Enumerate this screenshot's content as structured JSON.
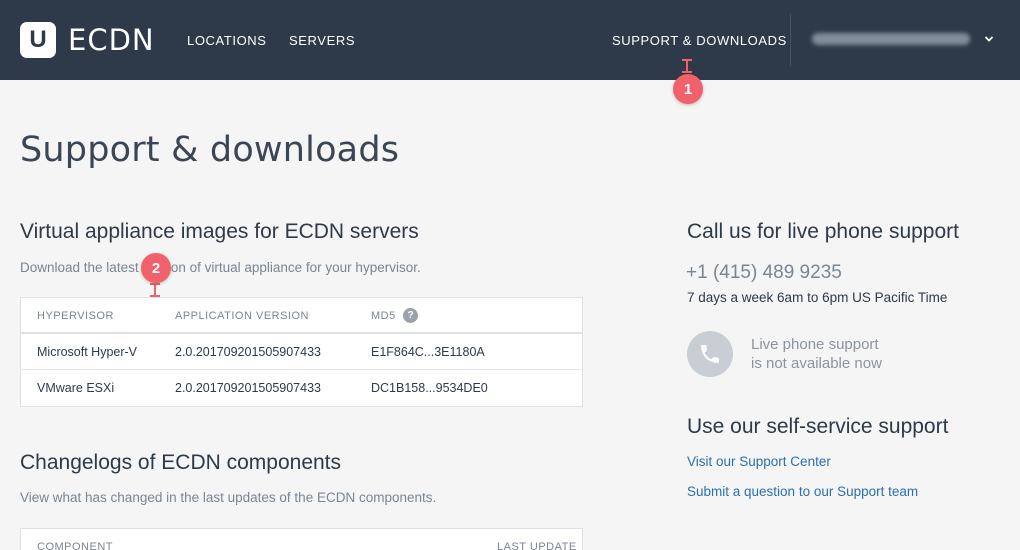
{
  "header": {
    "logo_mark": "U",
    "logo_text": "ECDN",
    "nav": [
      {
        "label": "LOCATIONS"
      },
      {
        "label": "SERVERS"
      }
    ],
    "support_link": "SUPPORT & DOWNLOADS"
  },
  "annotations": {
    "badge1": "1",
    "badge2": "2"
  },
  "page": {
    "title": "Support & downloads"
  },
  "appliances": {
    "heading": "Virtual appliance images for ECDN servers",
    "subtitle": "Download the latest version of virtual appliance for your hypervisor.",
    "columns": [
      "HYPERVISOR",
      "APPLICATION VERSION",
      "MD5"
    ],
    "rows": [
      {
        "hypervisor": "Microsoft Hyper-V",
        "version": "2.0.201709201505907433",
        "md5": "E1F864C...3E1180A"
      },
      {
        "hypervisor": "VMware ESXi",
        "version": "2.0.201709201505907433",
        "md5": "DC1B158...9534DE0"
      }
    ]
  },
  "changelogs": {
    "heading": "Changelogs of ECDN components",
    "subtitle": "View what has changed in the last updates of the ECDN components.",
    "columns": [
      "COMPONENT",
      "LAST UPDATE"
    ]
  },
  "support": {
    "heading": "Call us for live phone support",
    "phone": "+1 (415) 489 9235",
    "hours": "7 days a week 6am to 6pm US Pacific Time",
    "status_line1": "Live phone support",
    "status_line2": "is not available now",
    "self_heading": "Use our self-service support",
    "link_center": "Visit our Support Center",
    "link_question": "Submit a question to our Support team"
  },
  "colors": {
    "topbar": "#2e3a49",
    "accent_badge": "#f0616c",
    "link": "#2a6fb0"
  }
}
